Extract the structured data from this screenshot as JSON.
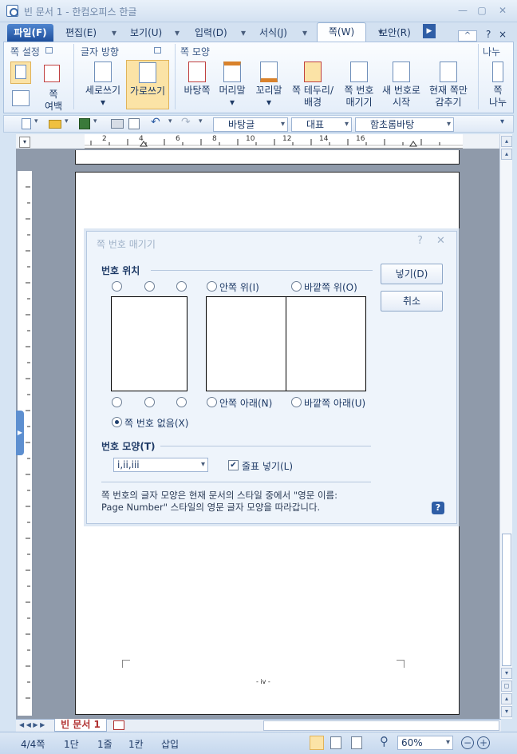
{
  "window": {
    "title": "빈 문서 1 - 한컴오피스 한글",
    "min": "—",
    "restore": "▢",
    "close": "✕"
  },
  "menubar": {
    "file": "파일(F)",
    "items": [
      "편집(E)",
      "보기(U)",
      "입력(D)",
      "서식(J)",
      "쪽(W)",
      "보안(R)"
    ],
    "help": "?",
    "close": "×",
    "up": "^"
  },
  "ribbon": {
    "groups": [
      "쪽 설정",
      "글자 방향",
      "쪽 모양",
      "나누"
    ],
    "page_setup": {
      "margin": "쪽\n여백"
    },
    "direction": {
      "vertical": "세로쓰기",
      "horizontal": "가로쓰기"
    },
    "page_shape": {
      "background": "바탕쪽",
      "header": "머리말",
      "footer": "꼬리말",
      "border": "쪽 테두리/\n배경",
      "page_number": "쪽 번호\n매기기",
      "new_number": "새 번호로\n시작",
      "hide": "현재 쪽만\n감추기",
      "break": "쪽\n나누"
    }
  },
  "qat": {
    "style": "바탕글",
    "lang": "대표",
    "font": "함초롬바탕"
  },
  "ruler": {
    "h_labels": [
      "2",
      "4",
      "6",
      "8",
      "10",
      "12",
      "14",
      "16"
    ]
  },
  "page": {
    "footer_text": "- iv -"
  },
  "dialog": {
    "title": "쪽 번호 매기기",
    "section_pos": "번호 위치",
    "inner_top": "안쪽 위(I)",
    "outer_top": "바깥쪽 위(O)",
    "inner_bottom": "안쪽 아래(N)",
    "outer_bottom": "바깥쪽 아래(U)",
    "none": "쪽 번호 없음(X)",
    "section_shape": "번호 모양(T)",
    "format": "i,ii,iii",
    "dash": "줄표 넣기(L)",
    "note1": "쪽 번호의 글자 모양은 현재 문서의 스타일 중에서 \"영문 이름:",
    "note2": "Page Number\" 스타일의 영문 글자 모양을 따라갑니다.",
    "ok": "넣기(D)",
    "cancel": "취소"
  },
  "doctab": {
    "name": "빈 문서 1"
  },
  "status": {
    "page": "4/4쪽",
    "section": "1단",
    "line": "1줄",
    "col": "1칸",
    "mode": "삽입",
    "zoom": "60%"
  }
}
